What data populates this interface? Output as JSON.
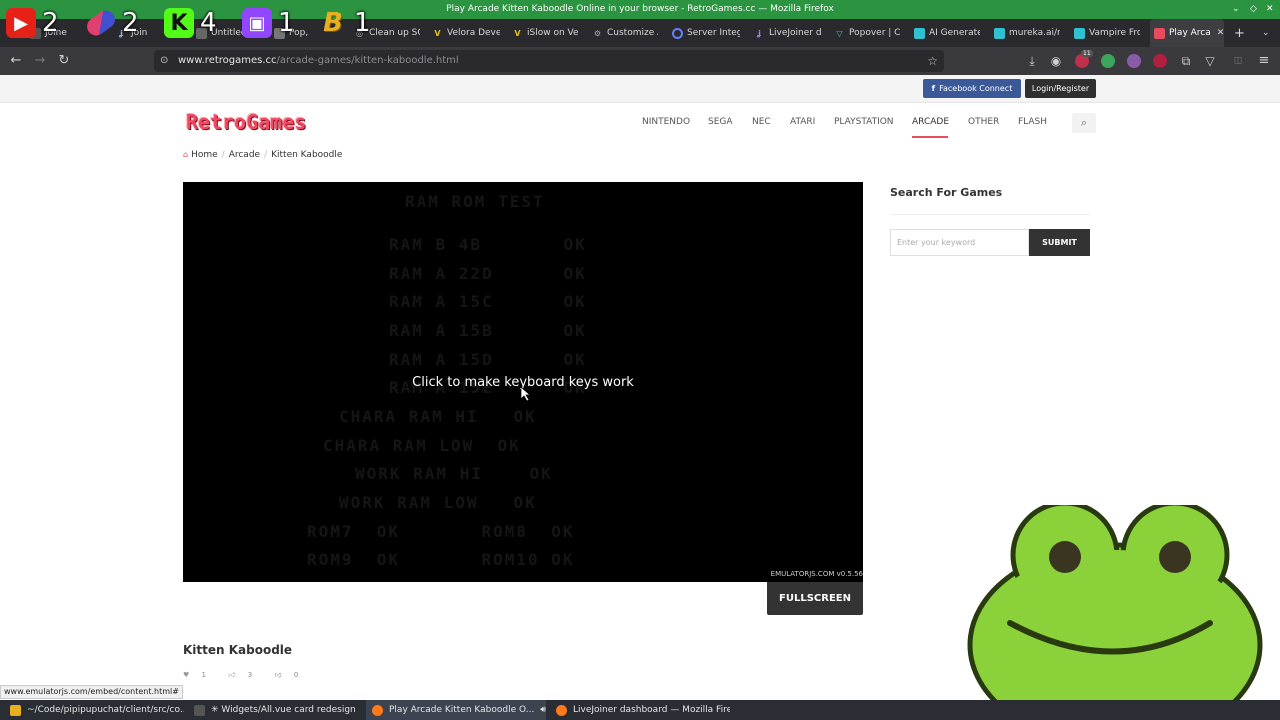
{
  "window": {
    "title": "Play Arcade Kitten Kaboodle Online in your browser - RetroGames.cc — Mozilla Firefox"
  },
  "overlay_badges": [
    {
      "icon": "youtube-icon",
      "count": "2",
      "color": "#e62117"
    },
    {
      "icon": "pill-icon",
      "count": "2",
      "color": "#c0306a"
    },
    {
      "icon": "kick-icon",
      "count": "4",
      "color": "#53fc18"
    },
    {
      "icon": "twitch-icon",
      "count": "1",
      "color": "#9146ff"
    },
    {
      "icon": "b-logo-icon",
      "count": "1",
      "color": "#e8b020"
    }
  ],
  "tabs": [
    {
      "label": "Joine",
      "active": false
    },
    {
      "label": "Join",
      "active": false
    },
    {
      "label": "Untitled",
      "active": false
    },
    {
      "label": "Pop,",
      "active": false
    },
    {
      "label": "Clean up SC",
      "active": false
    },
    {
      "label": "Velora Deve",
      "active": false
    },
    {
      "label": "iSlow on Vel",
      "active": false
    },
    {
      "label": "Customize A",
      "active": false
    },
    {
      "label": "Server Integ",
      "active": false
    },
    {
      "label": "LiveJoiner d",
      "active": false
    },
    {
      "label": "Popover | C",
      "active": false
    },
    {
      "label": "AI Generate",
      "active": false
    },
    {
      "label": "mureka.ai/r",
      "active": false
    },
    {
      "label": "Vampire Fro",
      "active": false
    },
    {
      "label": "Play Arca",
      "active": true
    }
  ],
  "navbar": {
    "url_host": "www.retrogames.cc",
    "url_path": "/arcade-games/kitten-kaboodle.html",
    "ext_badge": "11"
  },
  "site": {
    "facebook_label": "Facebook Connect",
    "login_label": "Login/Register",
    "logo": "RetroGames",
    "menu": [
      "NINTENDO",
      "SEGA",
      "NEC",
      "ATARI",
      "PLAYSTATION",
      "ARCADE",
      "OTHER",
      "FLASH"
    ],
    "active_menu": "ARCADE",
    "breadcrumb": [
      "Home",
      "Arcade",
      "Kitten Kaboodle"
    ]
  },
  "game": {
    "screen_lines": [
      "RAM ROM TEST",
      "RAM B 4B       OK",
      "RAM A 22D      OK",
      "RAM A 15C      OK",
      "RAM A 15B      OK",
      "RAM A 15D      OK",
      "RAM A 15E      OK",
      "CHARA RAM HI   OK",
      "CHARA RAM LOW  OK",
      "WORK RAM HI    OK",
      "WORK RAM LOW   OK",
      "ROM7  OK       ROM8  OK",
      "ROM9  OK       ROM10 OK"
    ],
    "click_message": "Click to make keyboard keys work",
    "emulator_version": "EMULATORJS.COM v0.5.56",
    "fullscreen_label": "FULLSCREEN",
    "title": "Kitten Kaboodle",
    "likes": "1",
    "favorites": "3",
    "dislikes": "0"
  },
  "sidebar": {
    "title": "Search For Games",
    "placeholder": "Enter your keyword",
    "submit_label": "SUBMIT"
  },
  "status_link": "www.emulatorjs.com/embed/content.html#",
  "taskbar": [
    {
      "label": "~/Code/pipipupuchat/client/src/co...",
      "active": false
    },
    {
      "label": "✳ Widgets/All.vue card redesign",
      "active": false
    },
    {
      "label": "Play Arcade Kitten Kaboodle O...",
      "active": true
    },
    {
      "label": "LiveJoiner dashboard — Mozilla Fire...",
      "active": false
    }
  ],
  "colors": {
    "accent": "#e94b5f",
    "titlebar": "#2b9440",
    "facebook": "#3b5998",
    "frog_green": "#8bd13a"
  }
}
